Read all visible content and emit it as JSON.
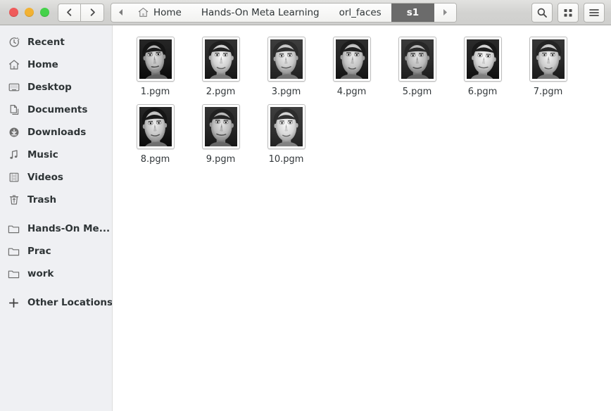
{
  "window": {
    "controls": [
      {
        "name": "close",
        "color": "#ef5b5b"
      },
      {
        "name": "minimize",
        "color": "#f2b233"
      },
      {
        "name": "maximize",
        "color": "#45d24a"
      }
    ]
  },
  "header": {
    "back_label": "Back",
    "forward_label": "Forward",
    "breadcrumbs": [
      {
        "label": "Home",
        "icon": "home-icon",
        "active": false
      },
      {
        "label": "Hands-On Meta Learning",
        "icon": "",
        "active": false
      },
      {
        "label": "orl_faces",
        "icon": "",
        "active": false
      },
      {
        "label": "s1",
        "icon": "",
        "active": true
      }
    ],
    "overflow_arrow": "◂",
    "next_arrow": "▸",
    "buttons": [
      {
        "name": "search-icon",
        "label": "Search"
      },
      {
        "name": "view-grid-icon",
        "label": "View options"
      },
      {
        "name": "hamburger-menu-icon",
        "label": "Menu"
      }
    ]
  },
  "sidebar": {
    "items": [
      {
        "label": "Recent",
        "icon": "clock-icon"
      },
      {
        "label": "Home",
        "icon": "home-icon"
      },
      {
        "label": "Desktop",
        "icon": "desktop-icon"
      },
      {
        "label": "Documents",
        "icon": "documents-icon"
      },
      {
        "label": "Downloads",
        "icon": "download-icon"
      },
      {
        "label": "Music",
        "icon": "music-note-icon"
      },
      {
        "label": "Videos",
        "icon": "film-icon"
      },
      {
        "label": "Trash",
        "icon": "trash-icon"
      },
      {
        "label": "Hands-On Me...",
        "icon": "folder-icon"
      },
      {
        "label": "Prac",
        "icon": "folder-icon"
      },
      {
        "label": "work",
        "icon": "folder-icon"
      }
    ],
    "other_locations": {
      "label": "Other Locations",
      "icon": "plus-icon"
    }
  },
  "files": [
    {
      "name": "1.pgm"
    },
    {
      "name": "2.pgm"
    },
    {
      "name": "3.pgm"
    },
    {
      "name": "4.pgm"
    },
    {
      "name": "5.pgm"
    },
    {
      "name": "6.pgm"
    },
    {
      "name": "7.pgm"
    },
    {
      "name": "8.pgm"
    },
    {
      "name": "9.pgm"
    },
    {
      "name": "10.pgm"
    }
  ],
  "colors": {
    "header_bg": "#d5d5d3",
    "sidebar_bg": "#eff0f3",
    "content_bg": "#ffffff",
    "active_crumb_bg": "#6b6b6b",
    "text": "#2e3436"
  }
}
